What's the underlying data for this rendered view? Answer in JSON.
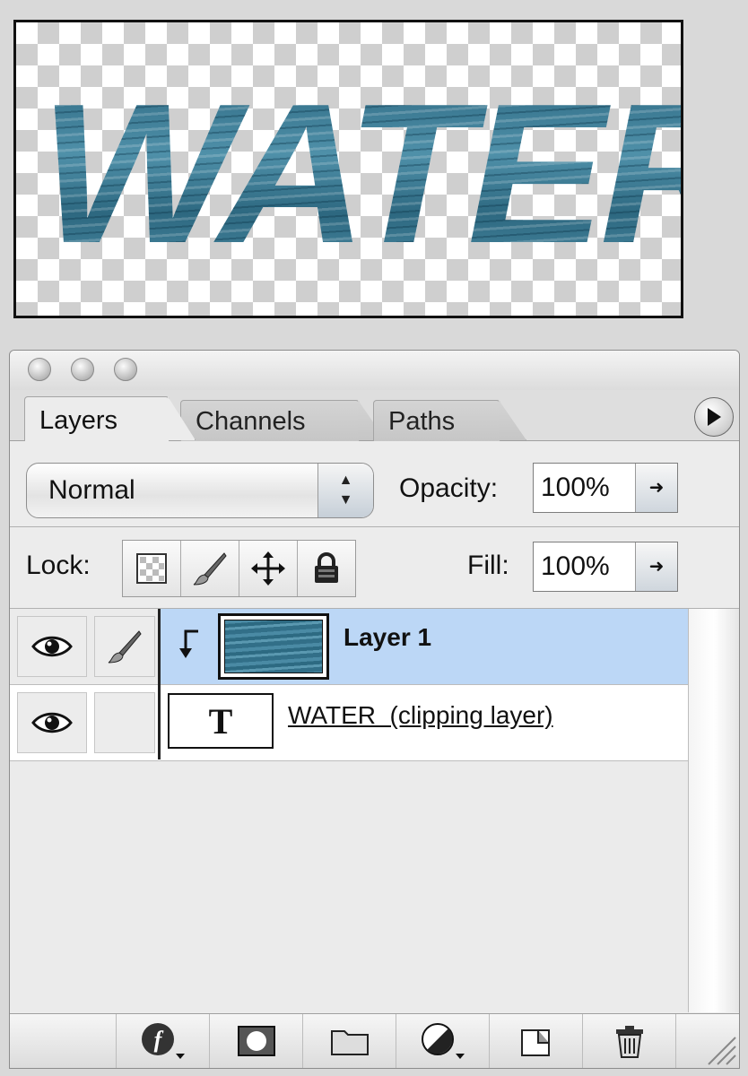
{
  "canvas": {
    "text": "WATER"
  },
  "panel": {
    "tabs": [
      {
        "label": "Layers",
        "active": true
      },
      {
        "label": "Channels",
        "active": false
      },
      {
        "label": "Paths",
        "active": false
      }
    ],
    "blend_mode": "Normal",
    "opacity_label": "Opacity:",
    "opacity_value": "100%",
    "lock_label": "Lock:",
    "fill_label": "Fill:",
    "fill_value": "100%",
    "layers": [
      {
        "name": "Layer 1",
        "selected": true,
        "visible": true,
        "clipped": true,
        "thumbnail": "water-texture"
      },
      {
        "name": "WATER  (clipping layer)",
        "selected": false,
        "visible": true,
        "type": "text",
        "thumbnail": "T"
      }
    ],
    "icons": {
      "lock": [
        "lock-transparent-pixels-icon",
        "lock-image-pixels-icon",
        "lock-position-icon",
        "lock-all-icon"
      ],
      "bottom": [
        "layer-style-icon",
        "layer-mask-icon",
        "new-group-icon",
        "adjustment-layer-icon",
        "new-layer-icon",
        "trash-icon"
      ]
    },
    "colors": {
      "selected_row": "#bcd7f6",
      "water": "#3d7d96"
    }
  }
}
